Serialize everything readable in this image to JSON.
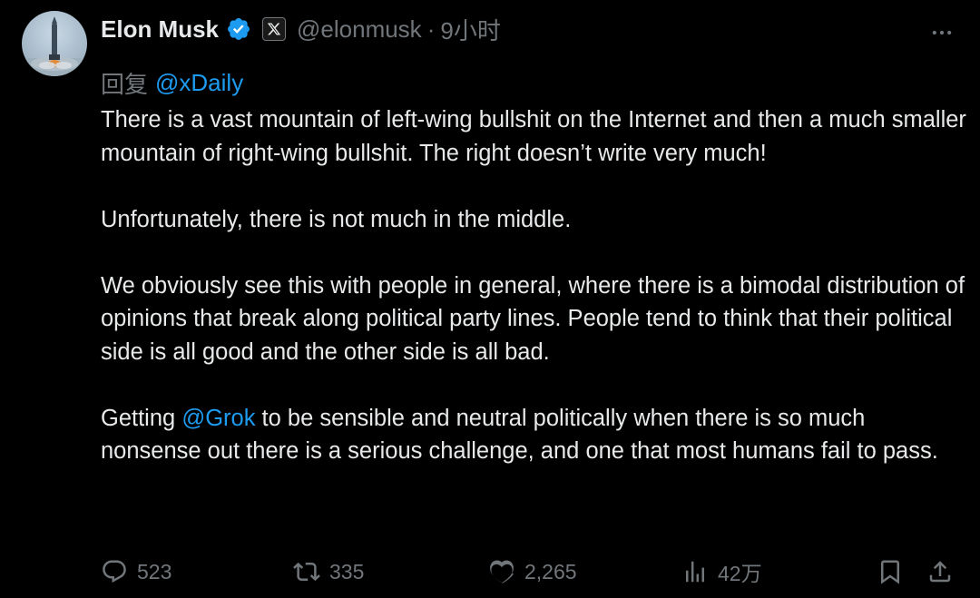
{
  "tweet": {
    "author": {
      "display_name": "Elon Musk",
      "handle": "@elonmusk",
      "verified": true,
      "affiliate_badge": "X"
    },
    "separator": "·",
    "time": "9小时",
    "reply_prefix": "回复",
    "reply_to": "@xDaily",
    "body": {
      "p1": "There is a vast mountain of left-wing bullshit on the Internet and then a much smaller mountain of right-wing bullshit. The right doesn’t write very much!",
      "p2": "Unfortunately, there is not much in the middle.",
      "p3": "We obviously see this with people in general, where there is a bimodal distribution of opinions that break along political party lines. People tend to think that their political side is all good and the other side is all bad.",
      "p4_before": "Getting ",
      "p4_mention": "@Grok",
      "p4_after": " to be sensible and neutral politically when there is so much nonsense out there is a serious challenge, and one that most humans fail to pass."
    },
    "actions": {
      "replies": "523",
      "retweets": "335",
      "likes": "2,265",
      "views": "42万"
    },
    "icons": [
      "avatar",
      "verified-icon",
      "x-affiliate-icon",
      "more-icon",
      "reply-icon",
      "retweet-icon",
      "like-icon",
      "views-icon",
      "bookmark-icon",
      "share-icon"
    ],
    "colors": {
      "background": "#000000",
      "text": "#e7e9ea",
      "secondary": "#71767b",
      "link": "#1d9bf0"
    }
  }
}
